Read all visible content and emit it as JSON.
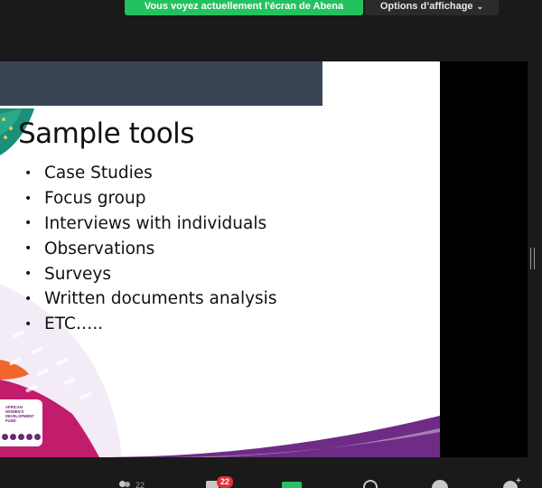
{
  "zoom": {
    "share_banner": "Vous voyez actuellement l'écran de Abena",
    "view_options_label": "Options d’affichage",
    "participant_count": "22",
    "chat_badge": "22"
  },
  "slide": {
    "title": "Sample tools",
    "bullets": [
      "Case Studies",
      "Focus group",
      "Interviews with individuals",
      "Observations",
      "Surveys",
      "Written documents analysis",
      "ETC….."
    ],
    "logo_text": "AFRICAN WOMEN'S DEVELOPMENT FUND"
  },
  "colors": {
    "share_green": "#23c25e",
    "slide_header": "#3a4554",
    "badge_red": "#e0303c"
  },
  "icons": [
    "chevron-down-icon",
    "participants-icon",
    "chat-icon",
    "share-screen-icon",
    "record-icon",
    "reactions-icon",
    "apps-icon"
  ]
}
